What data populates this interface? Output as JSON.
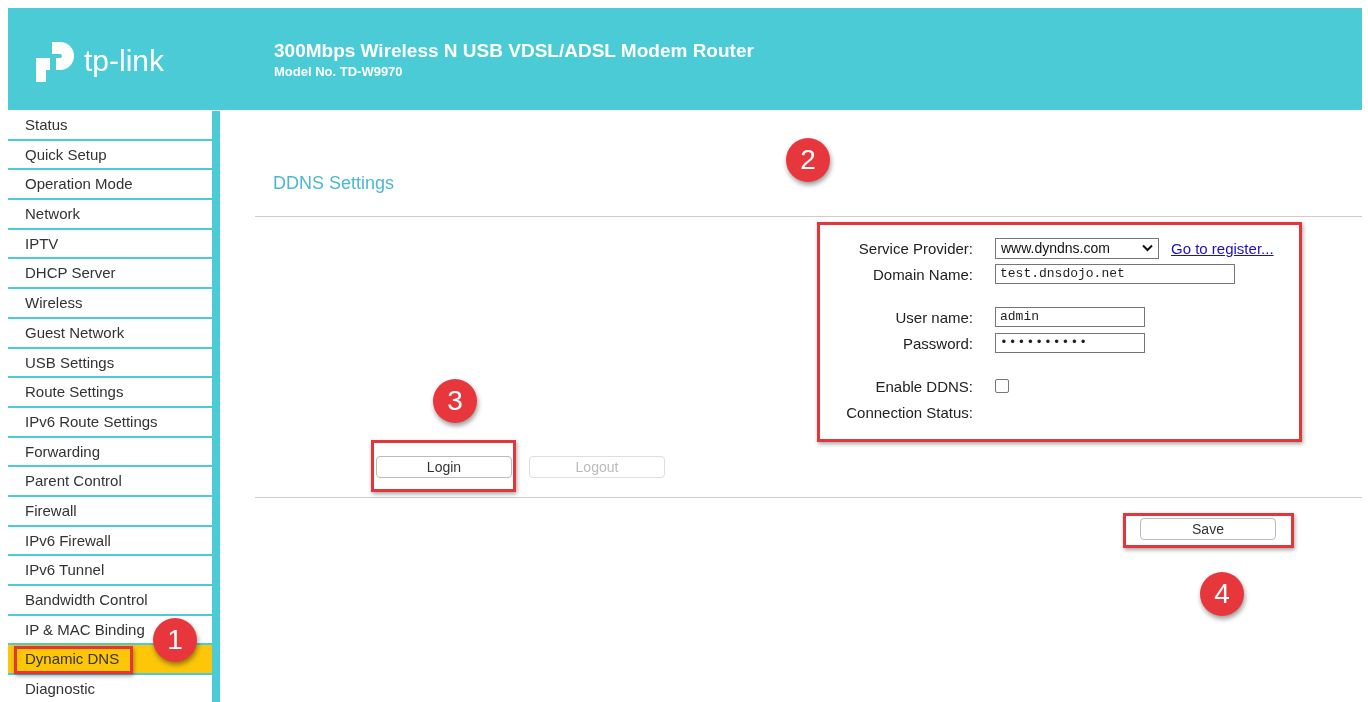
{
  "header": {
    "logo_text": "tp-link",
    "title": "300Mbps Wireless N USB VDSL/ADSL Modem Router",
    "model": "Model No. TD-W9970"
  },
  "sidebar": {
    "items": [
      {
        "label": "Status",
        "selected": false
      },
      {
        "label": "Quick Setup",
        "selected": false
      },
      {
        "label": "Operation Mode",
        "selected": false
      },
      {
        "label": "Network",
        "selected": false
      },
      {
        "label": "IPTV",
        "selected": false
      },
      {
        "label": "DHCP Server",
        "selected": false
      },
      {
        "label": "Wireless",
        "selected": false
      },
      {
        "label": "Guest Network",
        "selected": false
      },
      {
        "label": "USB Settings",
        "selected": false
      },
      {
        "label": "Route Settings",
        "selected": false
      },
      {
        "label": "IPv6 Route Settings",
        "selected": false
      },
      {
        "label": "Forwarding",
        "selected": false
      },
      {
        "label": "Parent Control",
        "selected": false
      },
      {
        "label": "Firewall",
        "selected": false
      },
      {
        "label": "IPv6 Firewall",
        "selected": false
      },
      {
        "label": "IPv6 Tunnel",
        "selected": false
      },
      {
        "label": "Bandwidth Control",
        "selected": false
      },
      {
        "label": "IP & MAC Binding",
        "selected": false
      },
      {
        "label": "Dynamic DNS",
        "selected": true
      },
      {
        "label": "Diagnostic",
        "selected": false
      }
    ]
  },
  "heading": "DDNS Settings",
  "form": {
    "groups": [
      [
        {
          "kind": "select",
          "label": "Service Provider:",
          "value": "www.dyndns.com",
          "link": "Go to register..."
        },
        {
          "kind": "text",
          "label": "Domain Name:",
          "value": "test.dnsdojo.net"
        }
      ],
      [
        {
          "kind": "text",
          "label": "User name:",
          "value": "admin"
        },
        {
          "kind": "password",
          "label": "Password:",
          "value": "••••••••••"
        }
      ],
      [
        {
          "kind": "checkbox",
          "label": "Enable DDNS:",
          "checked": false
        },
        {
          "kind": "status",
          "label": "Connection Status:"
        }
      ]
    ]
  },
  "buttons": [
    {
      "label": "Login",
      "disabled": false
    },
    {
      "label": "Logout",
      "disabled": true
    }
  ],
  "save_button": {
    "label": "Save",
    "disabled": false
  },
  "callouts": [
    "1",
    "2",
    "3",
    "4"
  ]
}
